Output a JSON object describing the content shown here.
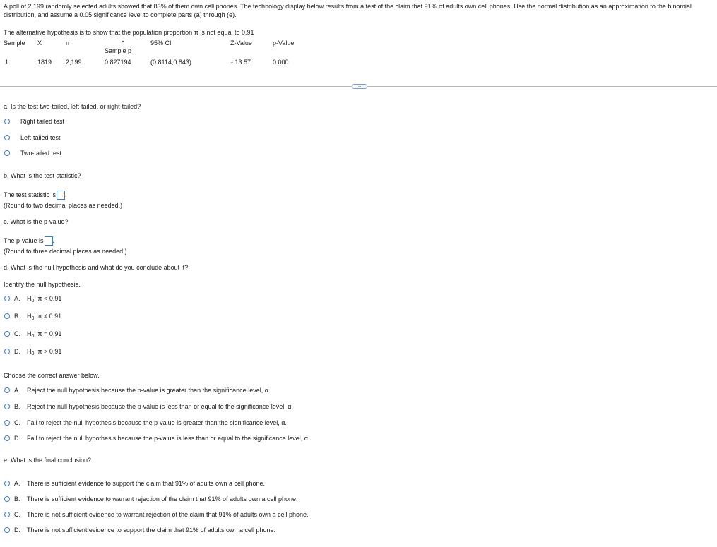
{
  "intro": "A poll of 2,199 randomly selected adults showed that 83% of them own cell phones. The technology display below results from a test of the claim that 91% of adults own cell phones. Use the normal distribution as an approximation to the binomial distribution, and assume a 0.05 significance level to complete parts (a) through (e).",
  "display": {
    "alt_line_prefix": "The alternative hypothesis is to show that the population proportion",
    "alt_line_pi": "π",
    "alt_line_suffix": "is not equal to 0.91",
    "headers": {
      "sample": "Sample",
      "x": "X",
      "n": "n",
      "hat": "^",
      "sample_p": "Sample p",
      "ci": "95% CI",
      "z": "Z-Value",
      "p": "p-Value"
    },
    "row": {
      "sample": "1",
      "x": "1819",
      "n": "2,199",
      "sample_p": "0.827194",
      "ci": "(0.8114,0.843)",
      "z": "- 13.57",
      "p": "0.000"
    },
    "more_label": "....."
  },
  "part_a": {
    "question": "a. Is the test two-tailed, left-tailed, or right-tailed?",
    "options": [
      "Right tailed test",
      "Left-tailed test",
      "Two-tailed test"
    ]
  },
  "part_b": {
    "question": "b. What is the test statistic?",
    "prompt": "The test statistic is",
    "period": ".",
    "hint": "(Round to two decimal places as needed.)"
  },
  "part_c": {
    "question": "c. What is the p-value?",
    "prompt": "The p-value is",
    "period": ".",
    "hint": "(Round to three decimal places as needed.)"
  },
  "part_d": {
    "question": "d. What is the null hypothesis and what do you conclude about it?",
    "identify": "Identify the null hypothesis.",
    "h0_options": [
      {
        "letter": "A.",
        "h": "H",
        "sub": "0",
        "rel": ": π < 0.91"
      },
      {
        "letter": "B.",
        "h": "H",
        "sub": "0",
        "rel": ": π ≠ 0.91"
      },
      {
        "letter": "C.",
        "h": "H",
        "sub": "0",
        "rel": ": π = 0.91"
      },
      {
        "letter": "D.",
        "h": "H",
        "sub": "0",
        "rel": ": π > 0.91"
      }
    ],
    "choose": "Choose the correct answer below.",
    "conclusions": [
      {
        "letter": "A.",
        "text": "Reject the null hypothesis because the p-value is greater than the significance level, α."
      },
      {
        "letter": "B.",
        "text": "Reject the null hypothesis because the p-value is less than or equal to the significance level, α."
      },
      {
        "letter": "C.",
        "text": "Fail to reject the null hypothesis because the p-value is greater than the significance level, α."
      },
      {
        "letter": "D.",
        "text": "Fail to reject the null hypothesis because the p-value is less than or equal to the significance level, α."
      }
    ]
  },
  "part_e": {
    "question": "e. What is the final conclusion?",
    "options": [
      {
        "letter": "A.",
        "text": "There is sufficient evidence to support the claim that 91% of adults own a cell phone."
      },
      {
        "letter": "B.",
        "text": "There is sufficient evidence to warrant rejection of the claim that 91% of adults own a cell phone."
      },
      {
        "letter": "C.",
        "text": "There is not sufficient evidence to warrant rejection of the claim that 91% of adults own a cell phone."
      },
      {
        "letter": "D.",
        "text": "There is not sufficient evidence to support the claim that 91% of adults own a cell phone."
      }
    ]
  },
  "colors": {
    "radio_border": "#3a7bd5",
    "divider": "#b8b8b8",
    "text": "#1a1a1a"
  }
}
